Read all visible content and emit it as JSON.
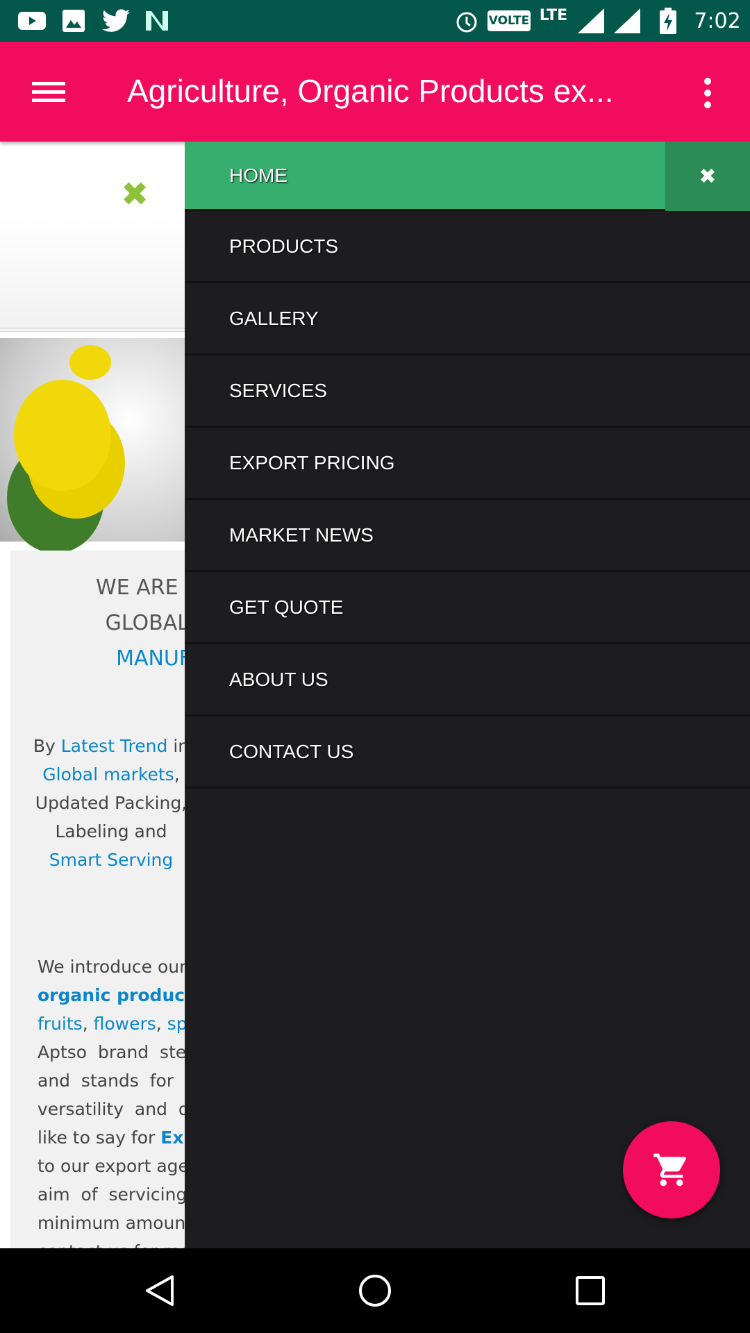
{
  "status_bar": {
    "time": "7:02",
    "network": "LTE",
    "volte": "VOLTE",
    "left_icons": [
      "youtube-icon",
      "gallery-icon",
      "twitter-icon",
      "n-icon"
    ]
  },
  "toolbar": {
    "title": "Agriculture, Organic Products ex..."
  },
  "drawer": {
    "items": [
      {
        "label": "HOME",
        "active": true
      },
      {
        "label": "PRODUCTS"
      },
      {
        "label": "GALLERY"
      },
      {
        "label": "SERVICES"
      },
      {
        "label": "EXPORT PRICING"
      },
      {
        "label": "MARKET NEWS"
      },
      {
        "label": "GET QUOTE"
      },
      {
        "label": "ABOUT US"
      },
      {
        "label": "CONTACT US"
      }
    ]
  },
  "content": {
    "headline": [
      "WE ARE PRESE",
      "GLOBAL CU",
      "MANUFA"
    ],
    "sub": {
      "by": "By",
      "latest": "Latest Trend",
      "in": "in",
      "global": "Global markets",
      ",": ",",
      "updated": "Updated Packing, Labeling and",
      "smart": "Smart Serving"
    },
    "para": {
      "l1": "We introduce ourse",
      "l2b": "organic products",
      "l3a": "fruits",
      "l3b": "flowers",
      "l3c": "sp",
      "l4": "Aptso  brand  ste",
      "l5": "and  stands  for  a",
      "l6": "versatility  and  dy",
      "l7a": "like to say for",
      "l7b": "Exp",
      "l8": "to our export age",
      "l9": "aim  of  servicing",
      "l10": "minimum amoun",
      "l11": "contact us for mo"
    }
  },
  "colors": {
    "status": "#03574b",
    "toolbar": "#f20c5d",
    "drawer": "#1d1d1f",
    "active": "#36ae6d",
    "link": "#0a86c9"
  }
}
